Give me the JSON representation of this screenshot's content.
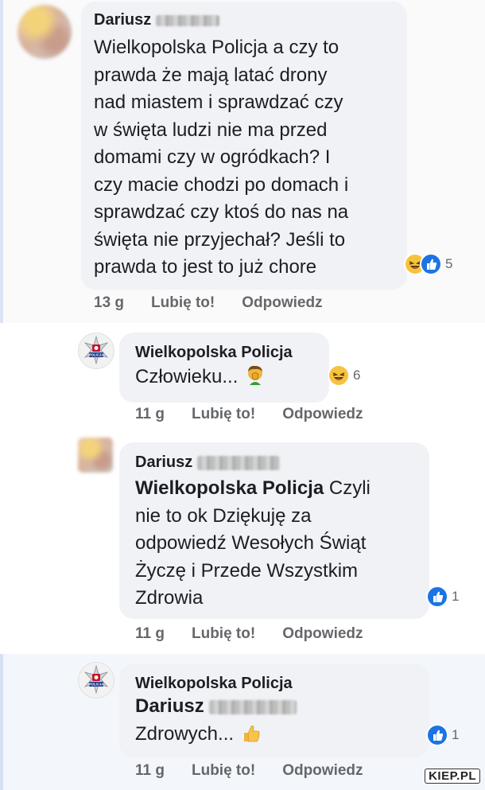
{
  "comments": [
    {
      "author": "Dariusz",
      "lines": [
        "Wielkopolska Policja a czy to",
        "prawda że mają latać drony",
        "nad miastem i sprawdzać czy",
        "w święta ludzi nie ma przed",
        "domami czy w ogródkach? I",
        "czy macie chodzi po domach i",
        "sprawdzać czy ktoś do nas na",
        "święta nie przyjechał? Jeśli to",
        "prawda to jest to już chore"
      ],
      "reactions": [
        "haha-icon",
        "like-icon"
      ],
      "reaction_count": "5",
      "time": "13 g",
      "like_label": "Lubię to!",
      "reply_label": "Odpowiedz"
    },
    {
      "author": "Wielkopolska Policja",
      "text": "Człowieku...",
      "emoji": "person-facepalming-emoji",
      "reactions": [
        "haha-icon"
      ],
      "reaction_count": "6",
      "time": "11 g",
      "like_label": "Lubię to!",
      "reply_label": "Odpowiedz"
    },
    {
      "author": "Dariusz",
      "mention": "Wielkopolska Policja",
      "lines": [
        "Czyli",
        "nie to ok Dziękuję za",
        "odpowiedź Wesołych Świąt",
        "Życzę i Przede Wszystkim",
        "Zdrowia"
      ],
      "reactions": [
        "like-icon"
      ],
      "reaction_count": "1",
      "time": "11 g",
      "like_label": "Lubię to!",
      "reply_label": "Odpowiedz"
    },
    {
      "author": "Wielkopolska Policja",
      "mention": "Dariusz",
      "text": "Zdrowych...",
      "emoji": "thumbs-up-emoji",
      "reactions": [
        "like-icon"
      ],
      "reaction_count": "1",
      "time": "11 g",
      "like_label": "Lubię to!",
      "reply_label": "Odpowiedz"
    }
  ],
  "police_badge_text": "POLICJA",
  "watermark": "KIEP.PL",
  "colors": {
    "bubble": "#f0f2f5",
    "meta_text": "#65676b",
    "like_blue": "#1b74e4",
    "haha_yellow": "#f7c33f"
  }
}
